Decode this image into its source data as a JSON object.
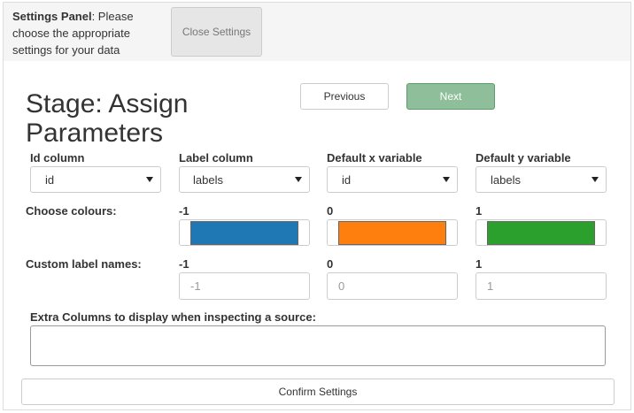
{
  "header": {
    "title": "Settings Panel",
    "description": ": Please choose the appropriate settings for your data",
    "close_label": "Close Settings"
  },
  "stage": {
    "title": "Stage: Assign Parameters"
  },
  "nav": {
    "previous_label": "Previous",
    "next_label": "Next"
  },
  "columns": {
    "id": {
      "label": "Id column",
      "value": "id"
    },
    "label": {
      "label": "Label column",
      "value": "labels"
    },
    "x": {
      "label": "Default x variable",
      "value": "id"
    },
    "y": {
      "label": "Default y variable",
      "value": "labels"
    }
  },
  "colours": {
    "label": "Choose colours:",
    "items": [
      {
        "key": "-1",
        "color": "#1f77b4"
      },
      {
        "key": "0",
        "color": "#ff7f0e"
      },
      {
        "key": "1",
        "color": "#2ca02c"
      }
    ]
  },
  "custom_labels": {
    "label": "Custom label names:",
    "items": [
      {
        "key": "-1",
        "placeholder": "-1"
      },
      {
        "key": "0",
        "placeholder": "0"
      },
      {
        "key": "1",
        "placeholder": "1"
      }
    ]
  },
  "extra_columns": {
    "label": "Extra Columns to display when inspecting a source:"
  },
  "confirm_label": "Confirm Settings"
}
